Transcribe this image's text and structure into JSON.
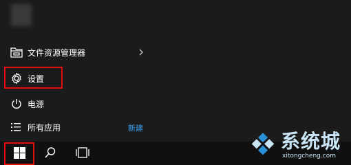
{
  "start_menu": {
    "items": [
      {
        "label": "文件资源管理器",
        "icon": "folder-explorer-icon"
      },
      {
        "label": "设置",
        "icon": "gear-icon"
      },
      {
        "label": "电源",
        "icon": "power-icon"
      },
      {
        "label": "所有应用",
        "icon": "list-icon"
      }
    ],
    "new_label": "新建"
  },
  "taskbar": {
    "icons": [
      "windows-logo-icon",
      "search-icon",
      "task-view-icon"
    ]
  },
  "watermark": {
    "text": "系统城",
    "url": "xitongcheng.com"
  },
  "colors": {
    "menu_bg": "#1b1b1b",
    "taskbar_bg": "#101010",
    "highlight_box": "#e01010",
    "accent_link": "#3b9ff0",
    "watermark": "#c9e4f4"
  }
}
